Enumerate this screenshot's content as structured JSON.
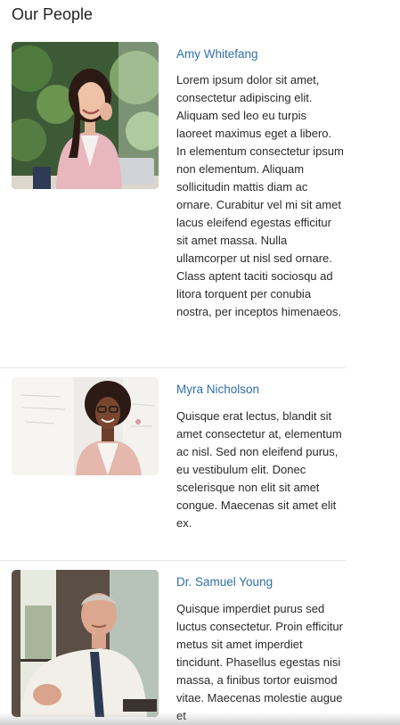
{
  "page": {
    "title": "Our People"
  },
  "people": [
    {
      "name": "Amy Whitefang",
      "bio": "Lorem ipsum dolor sit amet, consectetur adipiscing elit. Aliquam sed leo eu turpis laoreet maximus eget a libero. In elementum consectetur ipsum non elementum. Aliquam sollicitudin mattis diam ac ornare. Curabitur vel mi sit amet lacus eleifend egestas efficitur sit amet massa. Nulla ullamcorper ut nisl sed ornare. Class aptent taciti sociosqu ad litora torquent per conubia nostra, per inceptos himenaeos."
    },
    {
      "name": "Myra Nicholson",
      "bio": "Quisque erat lectus, blandit sit amet consectetur at, elementum ac nisl. Sed non eleifend purus, eu vestibulum elit. Donec scelerisque non elit sit amet congue. Maecenas sit amet elit ex."
    },
    {
      "name": "Dr. Samuel Young",
      "bio": "Quisque imperdiet purus sed luctus consectetur. Proin efficitur metus sit amet imperdiet tincidunt. Phasellus egestas nisi massa, a finibus tortor euismod vitae. Maecenas molestie augue et"
    }
  ],
  "colors": {
    "link": "#2f6fa7",
    "text": "#2a2a2a",
    "divider": "#e6e6e6"
  }
}
